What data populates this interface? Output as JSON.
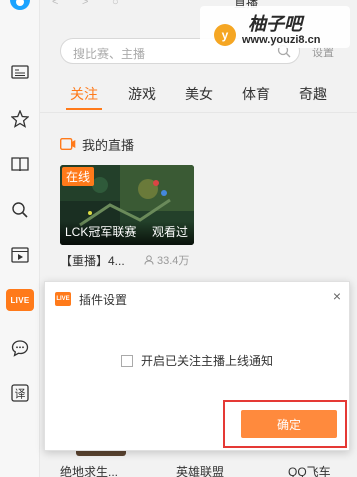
{
  "window": {
    "title": "直播"
  },
  "rail": {
    "live_badge": "LIVE"
  },
  "search": {
    "placeholder": "搜比赛、主播",
    "settings_label": "设置"
  },
  "tabs": [
    {
      "label": "关注",
      "active": true
    },
    {
      "label": "游戏",
      "active": false
    },
    {
      "label": "美女",
      "active": false
    },
    {
      "label": "体育",
      "active": false
    },
    {
      "label": "奇趣",
      "active": false
    }
  ],
  "my_live": {
    "title": "我的直播",
    "card": {
      "badge": "在线",
      "name": "LCK冠军联赛",
      "watched": "观看过",
      "title": "【重播】4...",
      "viewers": "33.4万"
    }
  },
  "bottom_games": [
    "绝地求生...",
    "英雄联盟",
    "QQ飞车"
  ],
  "dialog": {
    "badge": "LIVE",
    "title": "插件设置",
    "close": "×",
    "checkbox_label": "开启已关注主播上线通知",
    "checkbox_checked": false,
    "ok_label": "确定"
  },
  "watermark": {
    "initial": "y",
    "name": "柚子吧",
    "url": "www.youzi8.cn"
  },
  "colors": {
    "accent": "#ff7a1a",
    "highlight": "#e53935"
  }
}
